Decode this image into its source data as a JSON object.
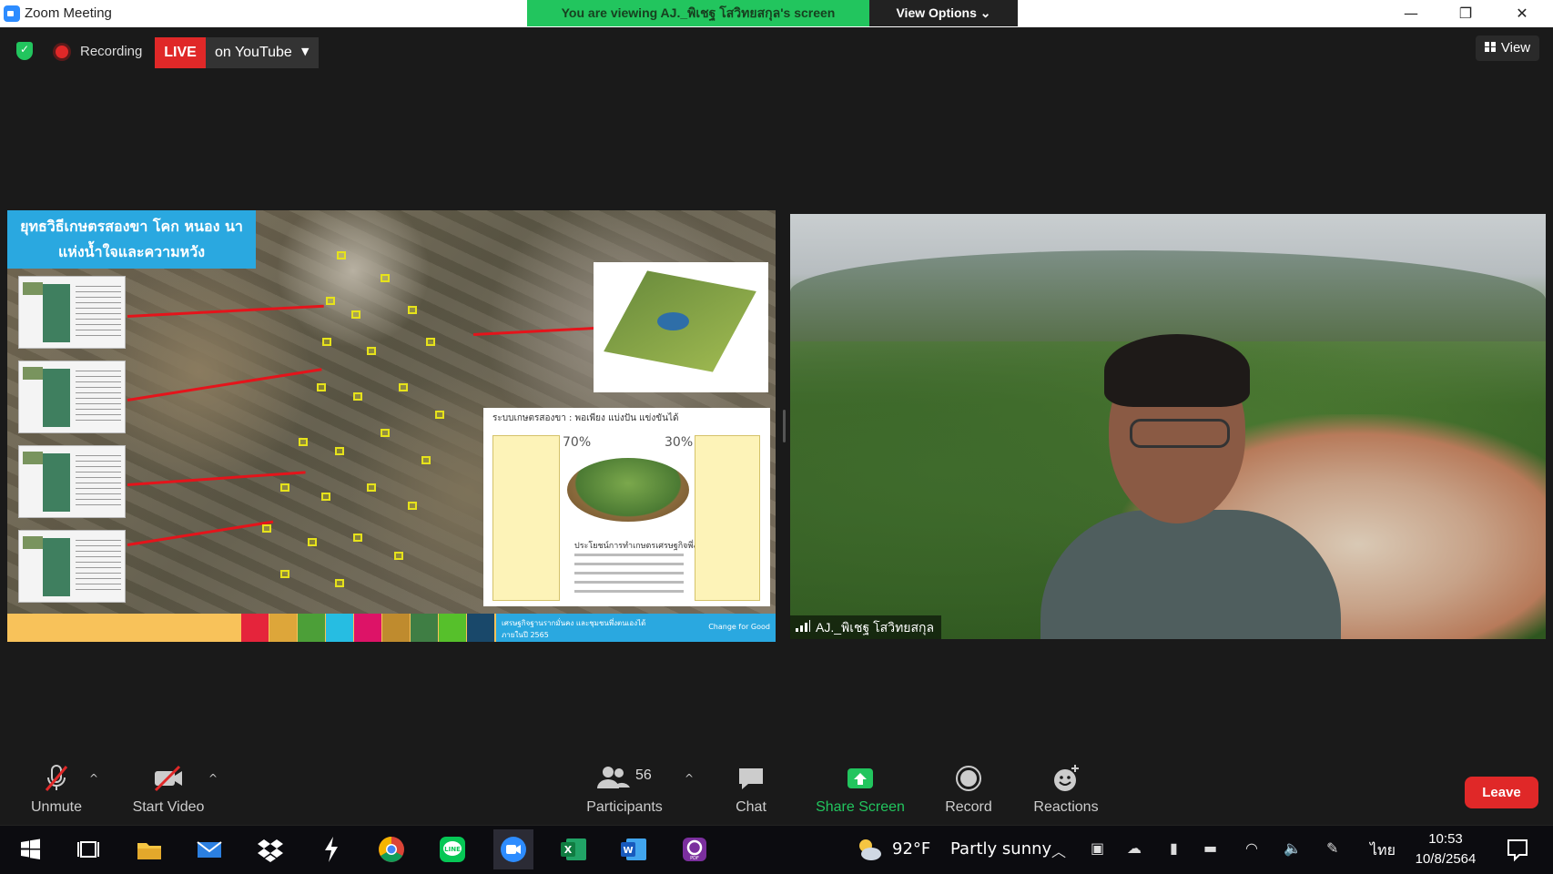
{
  "window": {
    "title": "Zoom Meeting"
  },
  "banner": {
    "viewing": "You are viewing AJ._พิเชฐ โสวิทยสกุล's screen",
    "view_options": "View Options ⌄"
  },
  "window_controls": {
    "minimize": "—",
    "restore": "❐",
    "close": "✕"
  },
  "status": {
    "recording": "Recording",
    "live": "LIVE",
    "live_destination": "on YouTube",
    "view": "View"
  },
  "slide": {
    "title_line1": "ยุทธวิธีเกษตรสองขา โคก หนอง นา",
    "title_line2": "แห่งน้ำใจและความหวัง",
    "system_title": "ระบบเกษตรสองขา : พอเพียง แบ่งปัน แข่งขันได้",
    "percent_left": "70%",
    "percent_right": "30%",
    "system_subtitle": "ประโยชน์การทำเกษตรเศรษฐกิจพึ่งตน",
    "footer_text": "เศรษฐกิจฐานรากมั่นคง และชุมชนพึ่งตนเองได้",
    "footer_year": "ภายในปี 2565",
    "footer_slogan": "Change for Good"
  },
  "video": {
    "participant_name": "AJ._พิเชฐ โสวิทยสกุล"
  },
  "toolbar": {
    "unmute": "Unmute",
    "start_video": "Start Video",
    "participants": "Participants",
    "participant_count": "56",
    "chat": "Chat",
    "share_screen": "Share Screen",
    "record": "Record",
    "reactions": "Reactions",
    "leave": "Leave"
  },
  "taskbar": {
    "weather_temp": "92°F",
    "weather_text": "Partly sunny",
    "language": "ไทย",
    "time": "10:53",
    "date": "10/8/2564"
  },
  "colors": {
    "live_red": "#e02828",
    "banner_green": "#22c55e",
    "share_green": "#22c55e",
    "zoom_blue": "#2d8cff"
  }
}
